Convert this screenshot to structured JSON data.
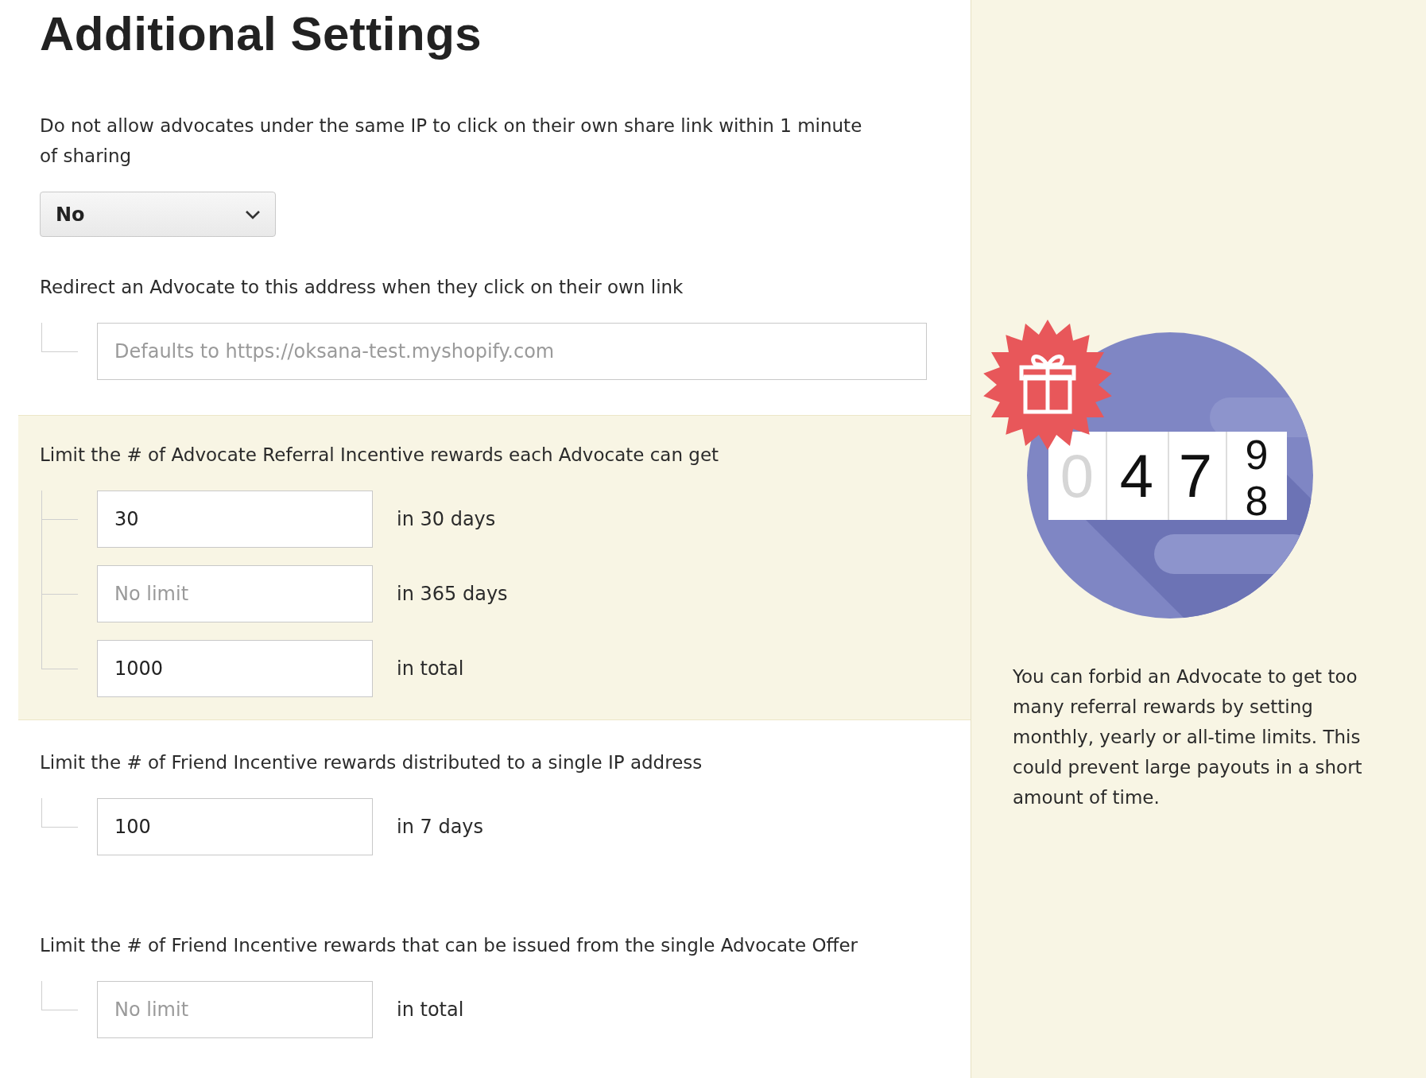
{
  "title": "Additional Settings",
  "sections": [
    {
      "kind": "select",
      "highlighted": false,
      "label": "Do not allow advocates under the same IP to click on their own share link within 1 minute of sharing",
      "select": {
        "value": "No"
      }
    },
    {
      "kind": "url",
      "highlighted": false,
      "label": "Redirect an Advocate to this address when they click on their own link",
      "rows": [
        {
          "placeholder": "Defaults to https://oksana-test.myshopify.com"
        }
      ]
    },
    {
      "kind": "limits",
      "highlighted": true,
      "label": "Limit the # of Advocate Referral Incentive rewards each Advocate can get",
      "rows": [
        {
          "value": "30",
          "suffix": "in 30 days"
        },
        {
          "placeholder": "No limit",
          "suffix": "in 365 days"
        },
        {
          "value": "1000",
          "suffix": "in total"
        }
      ]
    },
    {
      "kind": "limits",
      "highlighted": false,
      "label": "Limit the # of Friend Incentive rewards distributed to a single IP address",
      "rows": [
        {
          "value": "100",
          "suffix": "in 7 days"
        }
      ]
    },
    {
      "kind": "limits",
      "highlighted": false,
      "label": "Limit the # of Friend Incentive rewards that can be issued from the single Advocate Offer",
      "rows": [
        {
          "placeholder": "No limit",
          "suffix": "in total"
        }
      ]
    }
  ],
  "sidebar": {
    "counter": {
      "digits": [
        "0",
        "4",
        "7"
      ],
      "rolling": [
        "9",
        "8"
      ]
    },
    "text": "You can forbid an Advocate to get too many referral rewards by setting monthly, yearly or all-time limits. This could prevent large payouts in a short amount of time."
  }
}
